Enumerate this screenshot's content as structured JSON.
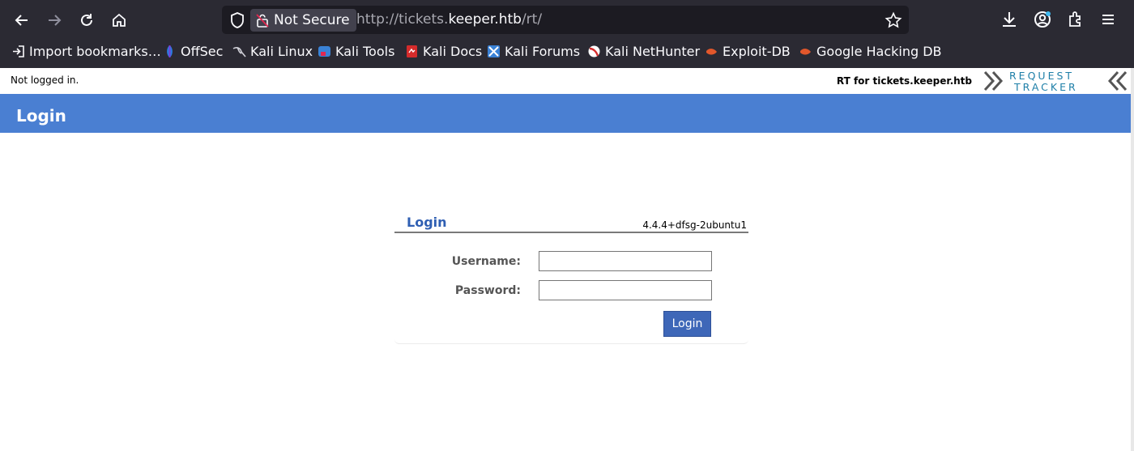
{
  "browser": {
    "url_scheme": "http://tickets.",
    "url_host": "keeper.htb",
    "url_path": "/rt/",
    "security_label": "Not Secure"
  },
  "bookmarks": [
    {
      "label": "Import bookmarks…",
      "icon": "import-icon",
      "color": "#fbfbfe"
    },
    {
      "label": "OffSec",
      "icon": "offsec-icon",
      "color": "#2a7de1"
    },
    {
      "label": "Kali Linux",
      "icon": "kali-dragon-icon",
      "color": "#000000"
    },
    {
      "label": "Kali Tools",
      "icon": "kali-tools-icon",
      "color": "#3a82d6"
    },
    {
      "label": "Kali Docs",
      "icon": "kali-docs-icon",
      "color": "#d52b2b"
    },
    {
      "label": "Kali Forums",
      "icon": "kali-forums-icon",
      "color": "#3a82d6"
    },
    {
      "label": "Kali NetHunter",
      "icon": "nethunter-icon",
      "color": "#d52b2b"
    },
    {
      "label": "Exploit-DB",
      "icon": "exploitdb-icon",
      "color": "#e2572b"
    },
    {
      "label": "Google Hacking DB",
      "icon": "ghdb-icon",
      "color": "#e2572b"
    }
  ],
  "rt": {
    "status": "Not logged in.",
    "rt_for": "RT for tickets.keeper.htb",
    "logo_line1": "REQUEST",
    "logo_line2": "TRACKER",
    "page_title": "Login"
  },
  "login": {
    "title": "Login",
    "version": "4.4.4+dfsg-2ubuntu1",
    "username_label": "Username:",
    "password_label": "Password:",
    "username_value": "",
    "password_value": "",
    "submit_label": "Login"
  },
  "colors": {
    "chrome_bg": "#2b2a33",
    "title_bar": "#4a7fd2",
    "login_button": "#3e67b8",
    "login_title": "#2f5fb3",
    "logo": "#1e7fa8"
  }
}
